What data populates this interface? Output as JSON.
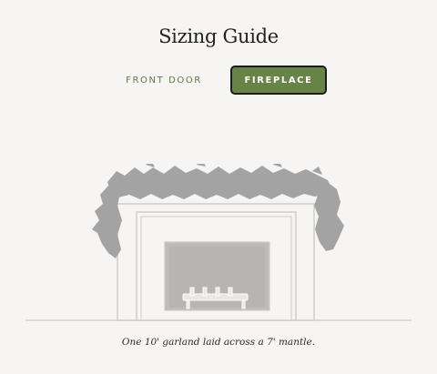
{
  "header": {
    "title": "Sizing Guide"
  },
  "tabs": [
    {
      "label": "FRONT DOOR",
      "active": false
    },
    {
      "label": "FIREPLACE",
      "active": true
    }
  ],
  "illustration": {
    "garland_color": "#a3a3a3",
    "outline_color": "#cccbc8",
    "fill_color": "#f6f5f3",
    "firebox_color": "#bdbcb9"
  },
  "caption": "One 10' garland laid across a 7' mantle."
}
